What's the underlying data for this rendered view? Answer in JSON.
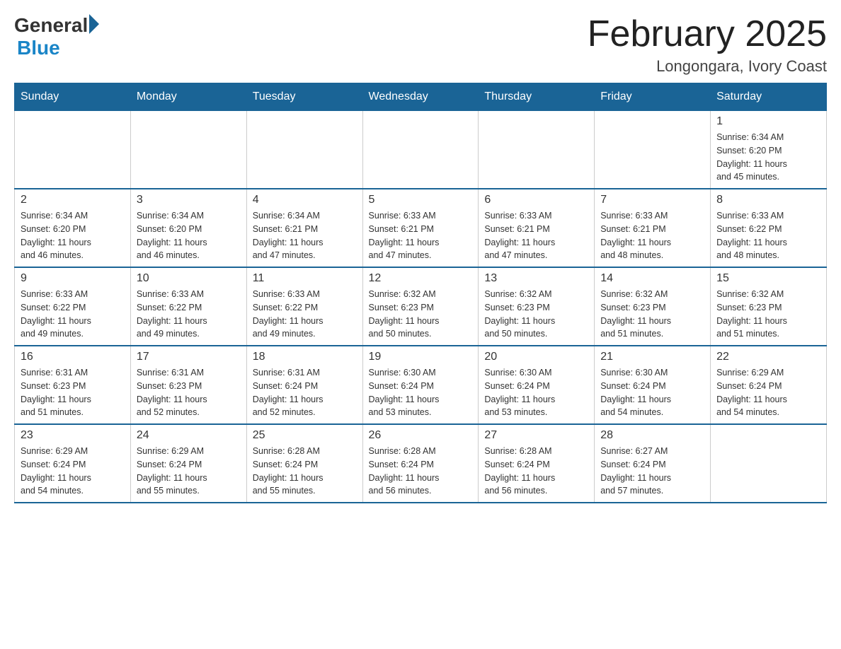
{
  "logo": {
    "general": "General",
    "blue": "Blue"
  },
  "header": {
    "title": "February 2025",
    "location": "Longongara, Ivory Coast"
  },
  "weekdays": [
    "Sunday",
    "Monday",
    "Tuesday",
    "Wednesday",
    "Thursday",
    "Friday",
    "Saturday"
  ],
  "weeks": [
    [
      {
        "day": "",
        "info": ""
      },
      {
        "day": "",
        "info": ""
      },
      {
        "day": "",
        "info": ""
      },
      {
        "day": "",
        "info": ""
      },
      {
        "day": "",
        "info": ""
      },
      {
        "day": "",
        "info": ""
      },
      {
        "day": "1",
        "info": "Sunrise: 6:34 AM\nSunset: 6:20 PM\nDaylight: 11 hours\nand 45 minutes."
      }
    ],
    [
      {
        "day": "2",
        "info": "Sunrise: 6:34 AM\nSunset: 6:20 PM\nDaylight: 11 hours\nand 46 minutes."
      },
      {
        "day": "3",
        "info": "Sunrise: 6:34 AM\nSunset: 6:20 PM\nDaylight: 11 hours\nand 46 minutes."
      },
      {
        "day": "4",
        "info": "Sunrise: 6:34 AM\nSunset: 6:21 PM\nDaylight: 11 hours\nand 47 minutes."
      },
      {
        "day": "5",
        "info": "Sunrise: 6:33 AM\nSunset: 6:21 PM\nDaylight: 11 hours\nand 47 minutes."
      },
      {
        "day": "6",
        "info": "Sunrise: 6:33 AM\nSunset: 6:21 PM\nDaylight: 11 hours\nand 47 minutes."
      },
      {
        "day": "7",
        "info": "Sunrise: 6:33 AM\nSunset: 6:21 PM\nDaylight: 11 hours\nand 48 minutes."
      },
      {
        "day": "8",
        "info": "Sunrise: 6:33 AM\nSunset: 6:22 PM\nDaylight: 11 hours\nand 48 minutes."
      }
    ],
    [
      {
        "day": "9",
        "info": "Sunrise: 6:33 AM\nSunset: 6:22 PM\nDaylight: 11 hours\nand 49 minutes."
      },
      {
        "day": "10",
        "info": "Sunrise: 6:33 AM\nSunset: 6:22 PM\nDaylight: 11 hours\nand 49 minutes."
      },
      {
        "day": "11",
        "info": "Sunrise: 6:33 AM\nSunset: 6:22 PM\nDaylight: 11 hours\nand 49 minutes."
      },
      {
        "day": "12",
        "info": "Sunrise: 6:32 AM\nSunset: 6:23 PM\nDaylight: 11 hours\nand 50 minutes."
      },
      {
        "day": "13",
        "info": "Sunrise: 6:32 AM\nSunset: 6:23 PM\nDaylight: 11 hours\nand 50 minutes."
      },
      {
        "day": "14",
        "info": "Sunrise: 6:32 AM\nSunset: 6:23 PM\nDaylight: 11 hours\nand 51 minutes."
      },
      {
        "day": "15",
        "info": "Sunrise: 6:32 AM\nSunset: 6:23 PM\nDaylight: 11 hours\nand 51 minutes."
      }
    ],
    [
      {
        "day": "16",
        "info": "Sunrise: 6:31 AM\nSunset: 6:23 PM\nDaylight: 11 hours\nand 51 minutes."
      },
      {
        "day": "17",
        "info": "Sunrise: 6:31 AM\nSunset: 6:23 PM\nDaylight: 11 hours\nand 52 minutes."
      },
      {
        "day": "18",
        "info": "Sunrise: 6:31 AM\nSunset: 6:24 PM\nDaylight: 11 hours\nand 52 minutes."
      },
      {
        "day": "19",
        "info": "Sunrise: 6:30 AM\nSunset: 6:24 PM\nDaylight: 11 hours\nand 53 minutes."
      },
      {
        "day": "20",
        "info": "Sunrise: 6:30 AM\nSunset: 6:24 PM\nDaylight: 11 hours\nand 53 minutes."
      },
      {
        "day": "21",
        "info": "Sunrise: 6:30 AM\nSunset: 6:24 PM\nDaylight: 11 hours\nand 54 minutes."
      },
      {
        "day": "22",
        "info": "Sunrise: 6:29 AM\nSunset: 6:24 PM\nDaylight: 11 hours\nand 54 minutes."
      }
    ],
    [
      {
        "day": "23",
        "info": "Sunrise: 6:29 AM\nSunset: 6:24 PM\nDaylight: 11 hours\nand 54 minutes."
      },
      {
        "day": "24",
        "info": "Sunrise: 6:29 AM\nSunset: 6:24 PM\nDaylight: 11 hours\nand 55 minutes."
      },
      {
        "day": "25",
        "info": "Sunrise: 6:28 AM\nSunset: 6:24 PM\nDaylight: 11 hours\nand 55 minutes."
      },
      {
        "day": "26",
        "info": "Sunrise: 6:28 AM\nSunset: 6:24 PM\nDaylight: 11 hours\nand 56 minutes."
      },
      {
        "day": "27",
        "info": "Sunrise: 6:28 AM\nSunset: 6:24 PM\nDaylight: 11 hours\nand 56 minutes."
      },
      {
        "day": "28",
        "info": "Sunrise: 6:27 AM\nSunset: 6:24 PM\nDaylight: 11 hours\nand 57 minutes."
      },
      {
        "day": "",
        "info": ""
      }
    ]
  ]
}
